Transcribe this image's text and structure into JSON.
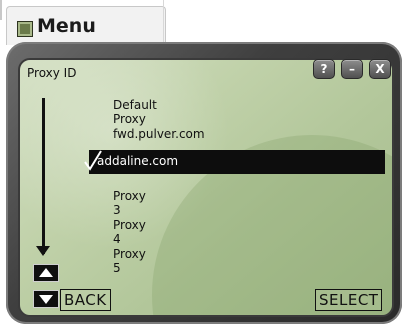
{
  "window": {
    "title": "Menu"
  },
  "dialog": {
    "heading": "Proxy ID",
    "buttons": {
      "help": "?",
      "minimize": "–",
      "close": "X"
    },
    "items": [
      {
        "label": "Default Proxy"
      },
      {
        "label": "fwd.pulver.com"
      },
      {
        "label": "addaline.com",
        "selected": true
      },
      {
        "label": "Proxy 3"
      },
      {
        "label": "Proxy 4"
      },
      {
        "label": "Proxy 5"
      }
    ],
    "softkeys": {
      "left": "BACK",
      "right": "SELECT"
    }
  },
  "colors": {
    "selection_bg": "#0d0d0d",
    "screen_bg": "#c0d1a9"
  }
}
